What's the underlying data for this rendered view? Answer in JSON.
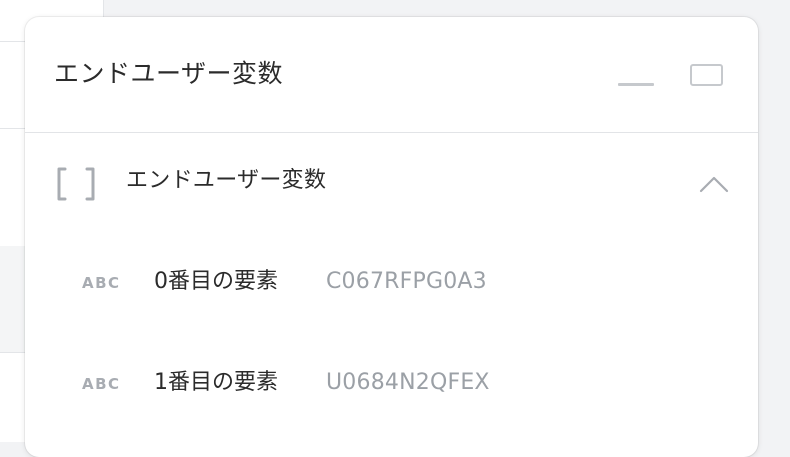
{
  "panel": {
    "title": "エンドユーザー変数"
  },
  "section": {
    "icon": "array-bracket-icon",
    "label": "エンドユーザー変数",
    "expanded": true
  },
  "items": [
    {
      "type_badge": "ABC",
      "label": "0番目の要素",
      "value": "C067RFPG0A3"
    },
    {
      "type_badge": "ABC",
      "label": "1番目の要素",
      "value": "U0684N2QFEX"
    }
  ],
  "colors": {
    "text": "#2b2b2b",
    "muted": "#9ba0a6",
    "icon": "#c6c9cd",
    "border": "#e2e4e7"
  }
}
